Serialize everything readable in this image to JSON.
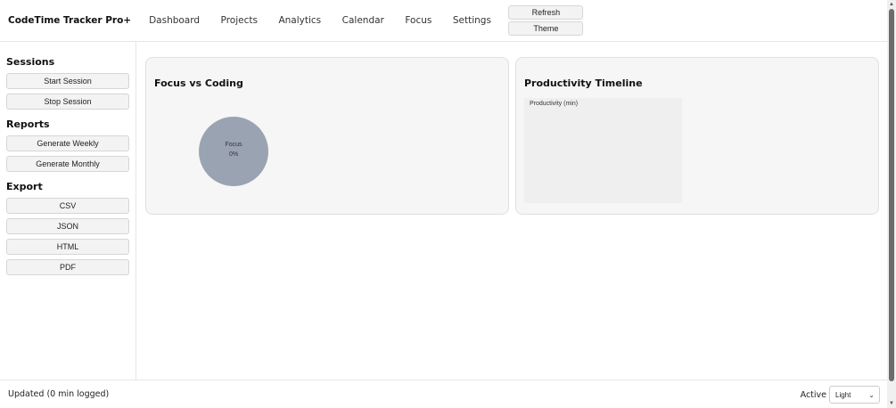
{
  "app": {
    "title": "CodeTime Tracker Pro+"
  },
  "nav": [
    "Dashboard",
    "Projects",
    "Analytics",
    "Calendar",
    "Focus",
    "Settings"
  ],
  "header_buttons": {
    "refresh": "Refresh",
    "theme": "Theme"
  },
  "sidebar": {
    "sessions": {
      "heading": "Sessions",
      "start": "Start Session",
      "stop": "Stop Session"
    },
    "reports": {
      "heading": "Reports",
      "weekly": "Generate Weekly",
      "monthly": "Generate Monthly"
    },
    "export": {
      "heading": "Export",
      "csv": "CSV",
      "json": "JSON",
      "html": "HTML",
      "pdf": "PDF"
    }
  },
  "cards": {
    "focus": {
      "title": "Focus vs Coding",
      "pie_label": "Focus",
      "pie_value": "0%",
      "pie_color": "#9aa3b2"
    },
    "timeline": {
      "title": "Productivity Timeline",
      "chart_label": "Productivity (min)"
    }
  },
  "footer": {
    "status": "Updated (0 min logged)",
    "active_label": "Active",
    "theme_selected": "Light"
  },
  "colors": {
    "accent_pie": "#9aa3b2",
    "card_bg": "#f6f6f6",
    "border": "#e0e0e0"
  }
}
